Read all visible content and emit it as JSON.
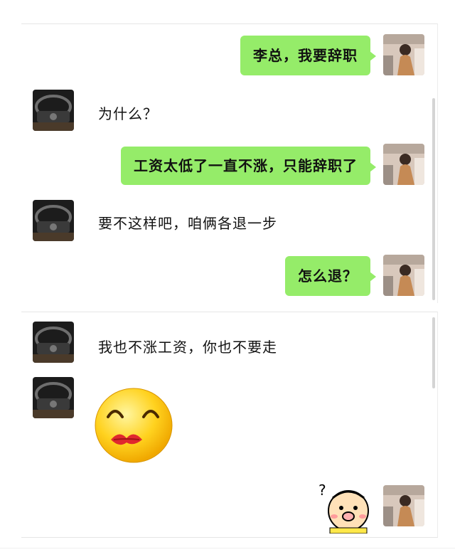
{
  "messages": [
    {
      "from": "me",
      "text": "李总，我要辞职"
    },
    {
      "from": "boss",
      "text": "为什么？"
    },
    {
      "from": "me",
      "text": "工资太低了一直不涨，只能辞职了"
    },
    {
      "from": "boss",
      "text": "要不这样吧，咱俩各退一步"
    },
    {
      "from": "me",
      "text": "怎么退？"
    },
    {
      "from": "boss",
      "text": "我也不涨工资，你也不要走"
    },
    {
      "from": "boss",
      "sticker": "kiss-face-emoji"
    },
    {
      "from": "me",
      "sticker": "confused-face-sticker"
    }
  ],
  "colors": {
    "my_bubble": "#95ec69",
    "background": "#ffffff"
  }
}
